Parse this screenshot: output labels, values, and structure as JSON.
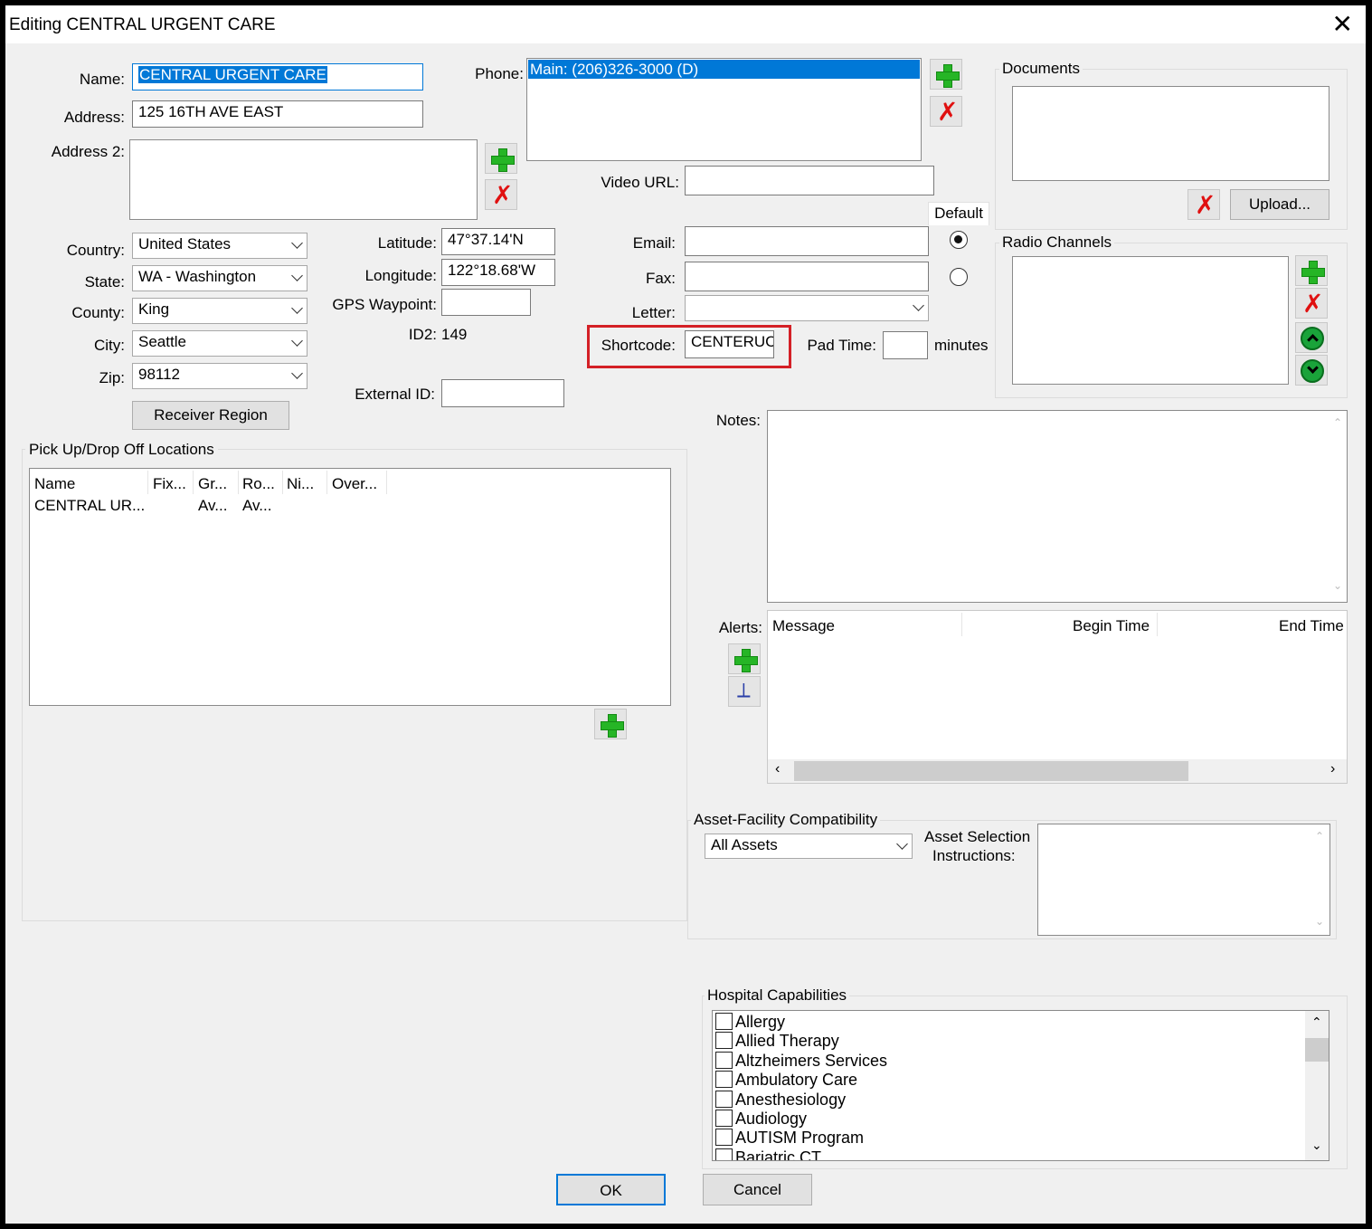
{
  "window": {
    "title": "Editing CENTRAL URGENT CARE",
    "close": "✕"
  },
  "fields": {
    "name_label": "Name:",
    "name_value": "CENTRAL URGENT CARE",
    "address_label": "Address:",
    "address_value": "125 16TH AVE EAST",
    "address2_label": "Address 2:",
    "country_label": "Country:",
    "country_value": "United States",
    "state_label": "State:",
    "state_value": "WA - Washington",
    "county_label": "County:",
    "county_value": "King",
    "city_label": "City:",
    "city_value": "Seattle",
    "zip_label": "Zip:",
    "zip_value": "98112",
    "receiver_region": "Receiver Region",
    "latitude_label": "Latitude:",
    "latitude_value": "47°37.14'N",
    "longitude_label": "Longitude:",
    "longitude_value": "122°18.68'W",
    "gps_label": "GPS Waypoint:",
    "id2_label": "ID2:",
    "id2_value": "149",
    "external_id_label": "External ID:",
    "phone_label": "Phone:",
    "phone_items": [
      "Main: (206)326-3000 (D)"
    ],
    "video_label": "Video URL:",
    "default_label": "Default",
    "email_label": "Email:",
    "fax_label": "Fax:",
    "letter_label": "Letter:",
    "shortcode_label": "Shortcode:",
    "shortcode_value": "CENTERUC",
    "padtime_label": "Pad Time:",
    "padtime_unit": "minutes",
    "notes_label": "Notes:",
    "alerts_label": "Alerts:"
  },
  "documents": {
    "title": "Documents",
    "upload": "Upload..."
  },
  "radio_channels": {
    "title": "Radio Channels"
  },
  "locations": {
    "title": "Pick Up/Drop Off Locations",
    "columns": [
      "Name",
      "Fix...",
      "Gr...",
      "Ro...",
      "Ni...",
      "Over..."
    ],
    "rows": [
      [
        "CENTRAL UR...",
        "",
        "Av...",
        "Av...",
        "",
        ""
      ]
    ]
  },
  "alerts": {
    "columns": [
      "Message",
      "Begin Time",
      "End Time"
    ]
  },
  "asset": {
    "title": "Asset-Facility Compatibility",
    "value": "All Assets",
    "instructions_label_1": "Asset Selection",
    "instructions_label_2": "Instructions:"
  },
  "capabilities": {
    "title": "Hospital Capabilities",
    "items": [
      "Allergy",
      "Allied Therapy",
      "Altzheimers Services",
      "Ambulatory Care",
      "Anesthesiology",
      "Audiology",
      "AUTISM Program",
      "Bariatric CT"
    ]
  },
  "buttons": {
    "ok": "OK",
    "cancel": "Cancel"
  },
  "colors": {
    "selection": "#0078d7",
    "highlight_box": "#d42026",
    "add_green": "#26b526",
    "delete_red": "#e01010"
  }
}
